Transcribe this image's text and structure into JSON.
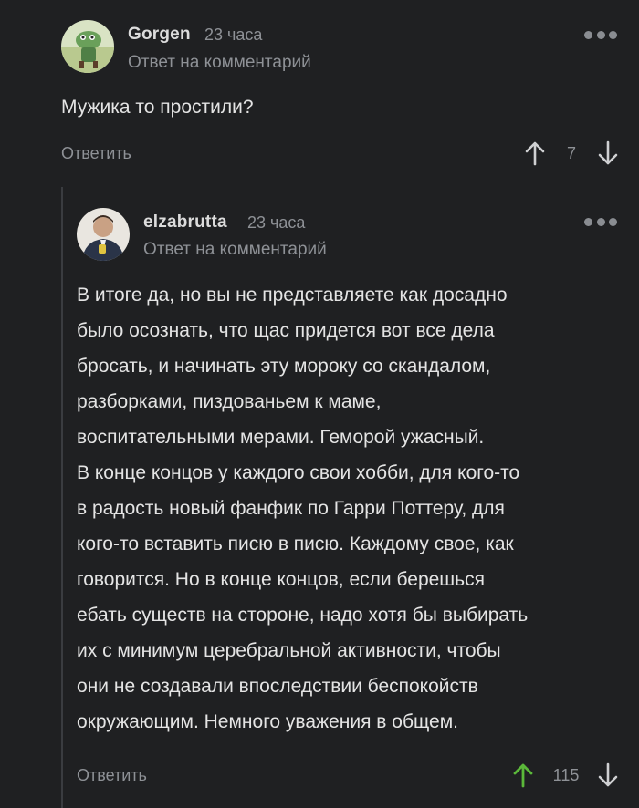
{
  "comments": [
    {
      "username": "Gorgen",
      "time": "23 часа",
      "reply_ref": "Ответ на комментарий",
      "text": "Мужика то простили?",
      "reply_label": "Ответить",
      "score": "7",
      "upvoted": false
    },
    {
      "username": "elzabrutta",
      "time": "23 часа",
      "reply_ref": "Ответ на комментарий",
      "text": "В итоге да, но вы не представляете как досадно\nбыло осознать, что щас придется вот все дела\nбросать, и начинать эту мороку со скандалом,\nразборками, пиздованьем к маме,\nвоспитательными мерами. Геморой ужасный.\nВ конце концов у каждого свои хобби, для кого-то\nв радость новый фанфик по Гарри Поттеру, для\nкого-то вставить писю в писю. Каждому свое, как\nговорится. Но в конце концов, если берешься\nебать существ на стороне, надо хотя бы выбирать\nих с минимум церебральной активности, чтобы\nони не создавали впоследствии беспокойств\nокружающим. Немного уважения в общем.",
      "reply_label": "Ответить",
      "score": "115",
      "upvoted": true
    }
  ],
  "colors": {
    "background": "#1f2022",
    "upvote_active": "#5bb83a",
    "muted": "#8e9196"
  }
}
